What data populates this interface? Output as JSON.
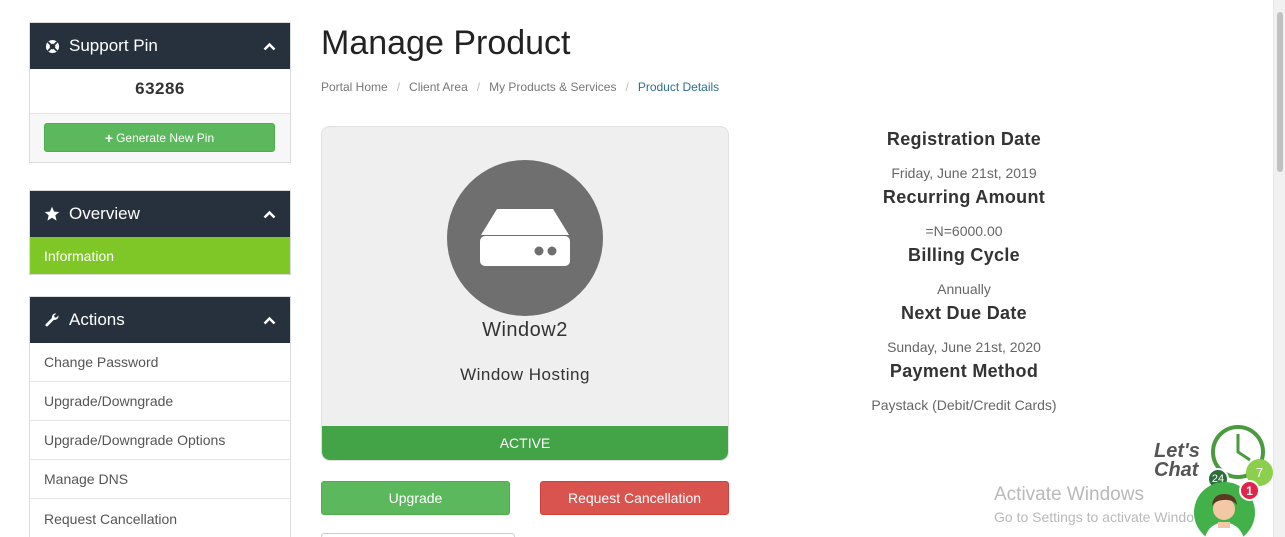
{
  "support_pin": {
    "title": "Support Pin",
    "pin": "63286",
    "generate_label": "Generate New Pin"
  },
  "overview": {
    "title": "Overview",
    "active_item": "Information"
  },
  "actions": {
    "title": "Actions",
    "items": [
      "Change Password",
      "Upgrade/Downgrade",
      "Upgrade/Downgrade Options",
      "Manage DNS",
      "Request Cancellation"
    ]
  },
  "page": {
    "title": "Manage Product",
    "breadcrumb": [
      "Portal Home",
      "Client Area",
      "My Products & Services",
      "Product Details"
    ]
  },
  "product": {
    "name": "Window2",
    "group": "Window Hosting",
    "status": "ACTIVE",
    "icon": "server-icon"
  },
  "buttons": {
    "upgrade": "Upgrade",
    "cancel": "Request Cancellation"
  },
  "details": {
    "registration_date_label": "Registration Date",
    "registration_date": "Friday, June 21st, 2019",
    "recurring_amount_label": "Recurring Amount",
    "recurring_amount": "=N=6000.00",
    "billing_cycle_label": "Billing Cycle",
    "billing_cycle": "Annually",
    "next_due_date_label": "Next Due Date",
    "next_due_date": "Sunday, June 21st, 2020",
    "payment_method_label": "Payment Method",
    "payment_method": "Paystack (Debit/Credit Cards)"
  },
  "watermark": {
    "title": "Activate Windows",
    "subtitle": "Go to Settings to activate Windows."
  },
  "chat": {
    "line1": "Let's",
    "line2": "Chat",
    "badge_24": "24",
    "badge_7": "7",
    "notifications": "1"
  },
  "colors": {
    "sidebar_header": "#26313d",
    "active_green": "#7fc627",
    "success": "#5cb85c",
    "danger": "#d9534f",
    "status_green": "#43a447"
  }
}
